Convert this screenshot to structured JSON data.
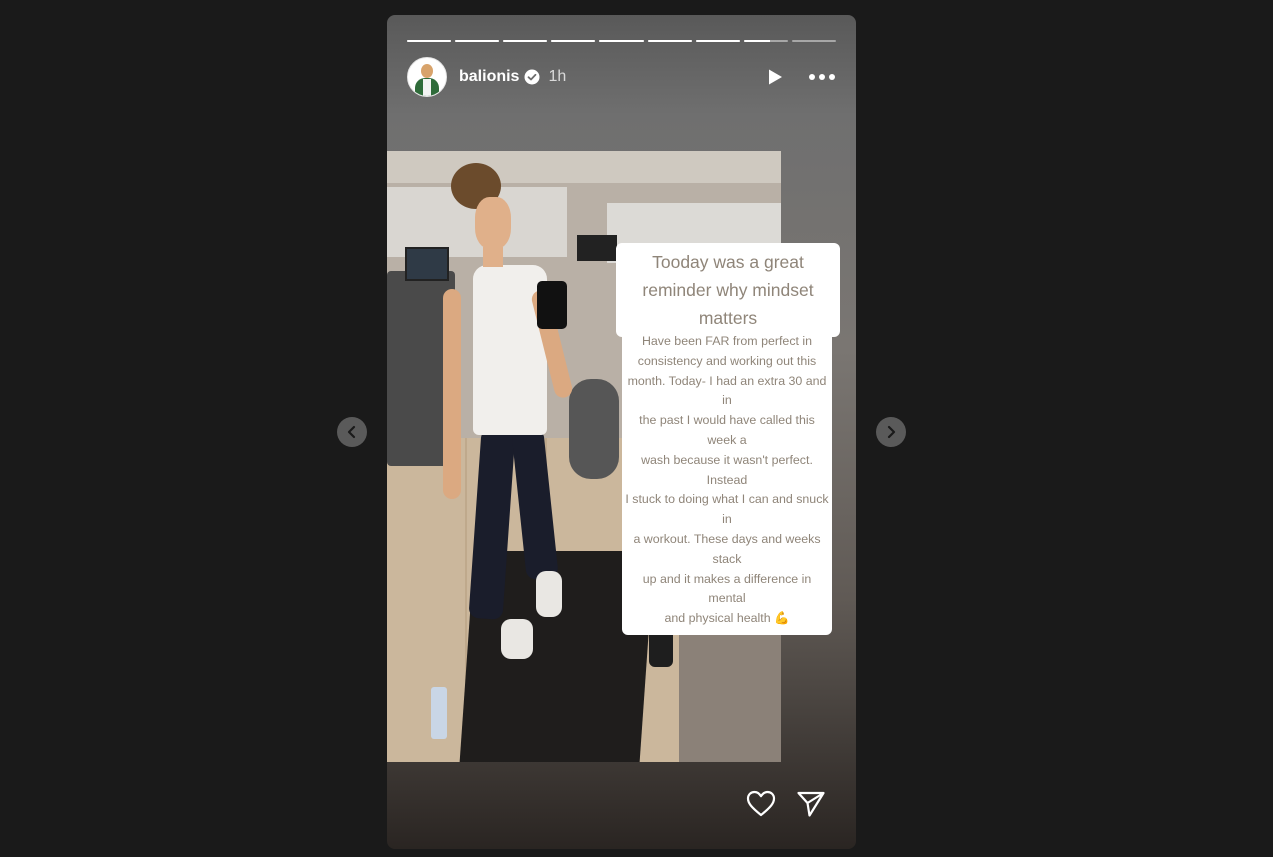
{
  "story": {
    "username": "balionis",
    "verified": true,
    "time_ago": "1h",
    "progress": {
      "segments": 9,
      "completed": 7,
      "current_fraction": 0.6
    },
    "overlay": {
      "headline_lines": [
        "Tooday was a great",
        "reminder why mindset matters"
      ],
      "body_lines": [
        "Have been FAR from perfect in",
        "consistency and working out this",
        "month. Today- I had an extra 30 and in",
        "the past I would have called this week a",
        "wash because it wasn't perfect. Instead",
        "I stuck to doing what I can and  snuck in",
        "a workout. These days and weeks stack",
        "up and it makes a difference in mental",
        "and physical health 💪"
      ]
    },
    "icons": {
      "play": "play-icon",
      "more": "more-options-icon",
      "verified": "verified-badge-icon",
      "like": "heart-icon",
      "share": "send-icon",
      "prev": "chevron-left-icon",
      "next": "chevron-right-icon"
    }
  },
  "colors": {
    "page_background": "#1a1a1a",
    "text_overlay": "#8f8579",
    "overlay_background": "#ffffff"
  }
}
